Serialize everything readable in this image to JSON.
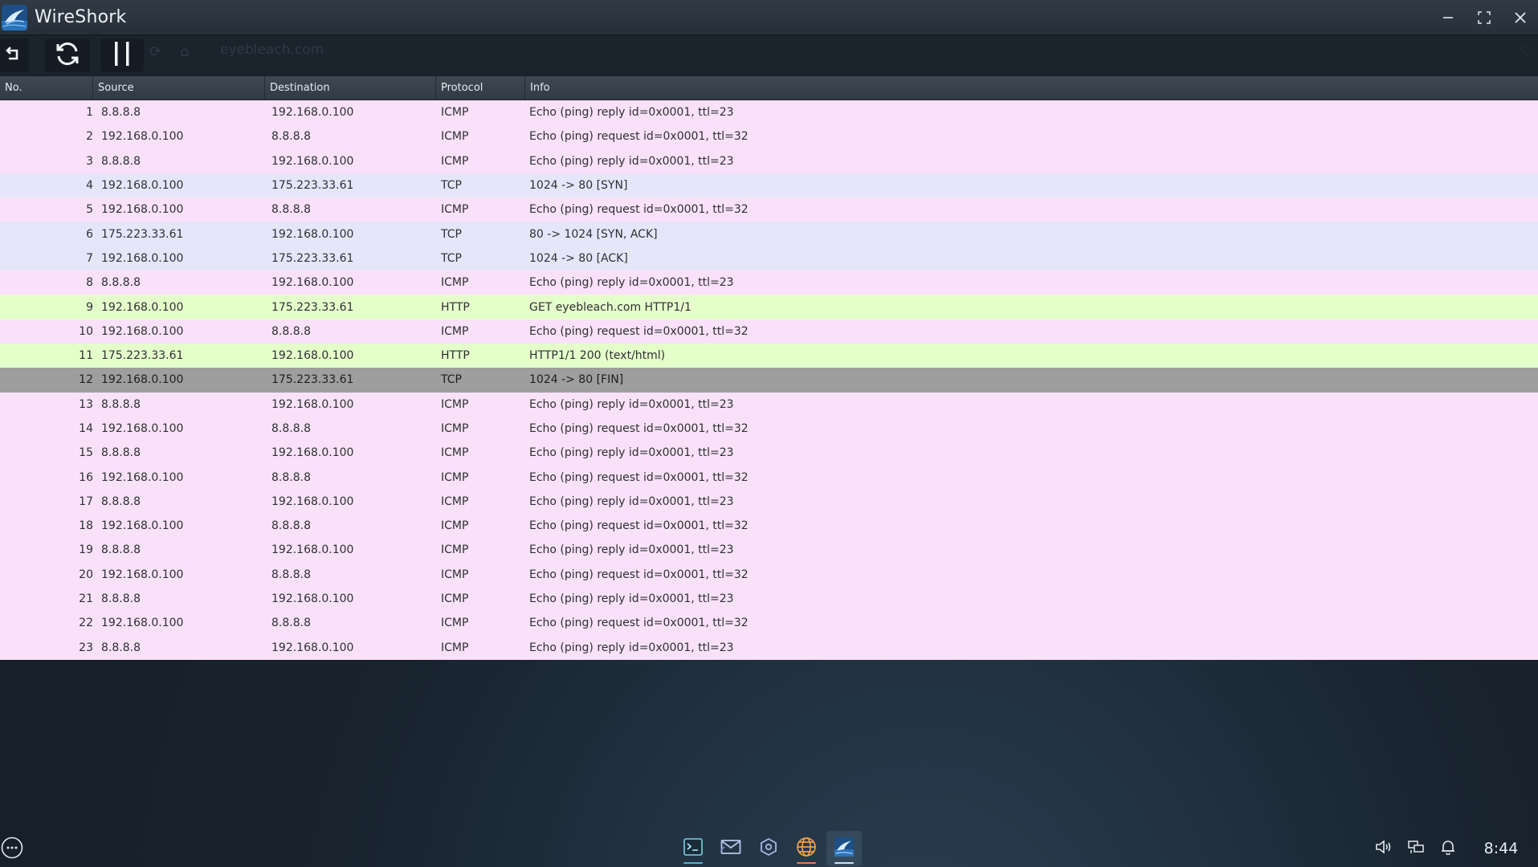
{
  "window": {
    "title": "WireShork"
  },
  "toolbar": {
    "back_icon": "undo-arrow-icon",
    "refresh_icon": "refresh-icon",
    "pause_icon": "pause-icon",
    "ghost_url": "eyebleach.com"
  },
  "table": {
    "columns": [
      "No.",
      "Source",
      "Destination",
      "Protocol",
      "Info"
    ],
    "rows": [
      {
        "no": "1",
        "src": "8.8.8.8",
        "dst": "192.168.0.100",
        "proto": "ICMP",
        "info": "Echo (ping) reply id=0x0001, ttl=23"
      },
      {
        "no": "2",
        "src": "192.168.0.100",
        "dst": "8.8.8.8",
        "proto": "ICMP",
        "info": "Echo (ping) request id=0x0001, ttl=32"
      },
      {
        "no": "3",
        "src": "8.8.8.8",
        "dst": "192.168.0.100",
        "proto": "ICMP",
        "info": "Echo (ping) reply id=0x0001, ttl=23"
      },
      {
        "no": "4",
        "src": "192.168.0.100",
        "dst": "175.223.33.61",
        "proto": "TCP",
        "info": "1024 -> 80 [SYN]"
      },
      {
        "no": "5",
        "src": "192.168.0.100",
        "dst": "8.8.8.8",
        "proto": "ICMP",
        "info": "Echo (ping) request id=0x0001, ttl=32"
      },
      {
        "no": "6",
        "src": "175.223.33.61",
        "dst": "192.168.0.100",
        "proto": "TCP",
        "info": "80 -> 1024 [SYN, ACK]"
      },
      {
        "no": "7",
        "src": "192.168.0.100",
        "dst": "175.223.33.61",
        "proto": "TCP",
        "info": "1024 -> 80 [ACK]"
      },
      {
        "no": "8",
        "src": "8.8.8.8",
        "dst": "192.168.0.100",
        "proto": "ICMP",
        "info": "Echo (ping) reply id=0x0001, ttl=23"
      },
      {
        "no": "9",
        "src": "192.168.0.100",
        "dst": "175.223.33.61",
        "proto": "HTTP",
        "info": "GET eyebleach.com HTTP1/1"
      },
      {
        "no": "10",
        "src": "192.168.0.100",
        "dst": "8.8.8.8",
        "proto": "ICMP",
        "info": "Echo (ping) request id=0x0001, ttl=32"
      },
      {
        "no": "11",
        "src": "175.223.33.61",
        "dst": "192.168.0.100",
        "proto": "HTTP",
        "info": "HTTP1/1 200 (text/html)"
      },
      {
        "no": "12",
        "src": "192.168.0.100",
        "dst": "175.223.33.61",
        "proto": "TCP",
        "info": "1024 -> 80 [FIN]",
        "selected": true
      },
      {
        "no": "13",
        "src": "8.8.8.8",
        "dst": "192.168.0.100",
        "proto": "ICMP",
        "info": "Echo (ping) reply id=0x0001, ttl=23"
      },
      {
        "no": "14",
        "src": "192.168.0.100",
        "dst": "8.8.8.8",
        "proto": "ICMP",
        "info": "Echo (ping) request id=0x0001, ttl=32"
      },
      {
        "no": "15",
        "src": "8.8.8.8",
        "dst": "192.168.0.100",
        "proto": "ICMP",
        "info": "Echo (ping) reply id=0x0001, ttl=23"
      },
      {
        "no": "16",
        "src": "192.168.0.100",
        "dst": "8.8.8.8",
        "proto": "ICMP",
        "info": "Echo (ping) request id=0x0001, ttl=32"
      },
      {
        "no": "17",
        "src": "8.8.8.8",
        "dst": "192.168.0.100",
        "proto": "ICMP",
        "info": "Echo (ping) reply id=0x0001, ttl=23"
      },
      {
        "no": "18",
        "src": "192.168.0.100",
        "dst": "8.8.8.8",
        "proto": "ICMP",
        "info": "Echo (ping) request id=0x0001, ttl=32"
      },
      {
        "no": "19",
        "src": "8.8.8.8",
        "dst": "192.168.0.100",
        "proto": "ICMP",
        "info": "Echo (ping) reply id=0x0001, ttl=23"
      },
      {
        "no": "20",
        "src": "192.168.0.100",
        "dst": "8.8.8.8",
        "proto": "ICMP",
        "info": "Echo (ping) request id=0x0001, ttl=32"
      },
      {
        "no": "21",
        "src": "8.8.8.8",
        "dst": "192.168.0.100",
        "proto": "ICMP",
        "info": "Echo (ping) reply id=0x0001, ttl=23"
      },
      {
        "no": "22",
        "src": "192.168.0.100",
        "dst": "8.8.8.8",
        "proto": "ICMP",
        "info": "Echo (ping) request id=0x0001, ttl=32"
      },
      {
        "no": "23",
        "src": "8.8.8.8",
        "dst": "192.168.0.100",
        "proto": "ICMP",
        "info": "Echo (ping) reply id=0x0001, ttl=23"
      }
    ]
  },
  "colors": {
    "icmp_row": "#f9e2f9",
    "tcp_row": "#e6e6fa",
    "http_row": "#e5ffcb",
    "selected_row": "#9e9e9e",
    "header_bg": "#3a434d",
    "titlebar_bg": "#2b343e",
    "desktop_bg": "#18222c"
  },
  "taskbar": {
    "start_icon": "ellipsis-circle-icon",
    "dock": [
      {
        "name": "terminal-icon",
        "indicator": "#4fb6c7"
      },
      {
        "name": "mail-icon",
        "indicator": ""
      },
      {
        "name": "hexagon-settings-icon",
        "indicator": ""
      },
      {
        "name": "globe-browser-icon",
        "indicator": "#e77a4a"
      },
      {
        "name": "wireshork-app-icon",
        "indicator": "#cfe3f5",
        "active": true
      }
    ],
    "tray": [
      "volume-icon",
      "network-icon",
      "bell-icon"
    ],
    "clock": "8:44"
  }
}
